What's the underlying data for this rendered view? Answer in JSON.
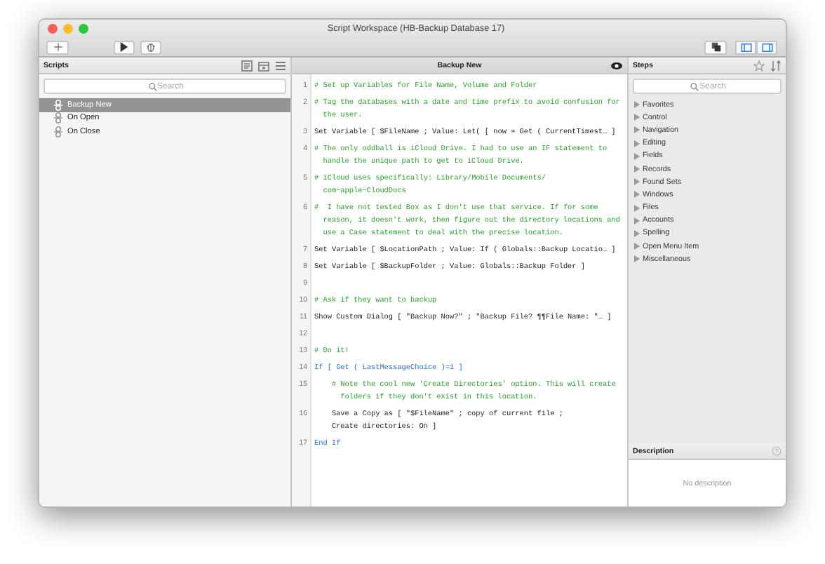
{
  "window": {
    "title": "Script Workspace (HB-Backup Database 17)"
  },
  "toolbar": {
    "pane_toggles": [
      {
        "selected": true
      },
      {
        "selected": true
      }
    ]
  },
  "scripts_pane": {
    "title": "Scripts",
    "search": {
      "placeholder": "Search"
    },
    "items": [
      {
        "label": "Backup New",
        "selected": true
      },
      {
        "label": "On Open",
        "selected": false
      },
      {
        "label": "On Close",
        "selected": false
      }
    ]
  },
  "editor": {
    "title": "Backup New",
    "lines": [
      {
        "number": "1",
        "kind": "comment",
        "text": "# Set up Variables for File Name, Volume and Folder"
      },
      {
        "number": "2",
        "kind": "comment",
        "text": "# Tag the databases with a date and time prefix to avoid confusion for the user."
      },
      {
        "number": "3",
        "kind": "step",
        "text": "Set Variable [ $FileName ; Value: Let( [ now = Get ( CurrentTimest… ]"
      },
      {
        "number": "4",
        "kind": "comment",
        "text": "# The only oddball is iCloud Drive. I had to use an IF statement to handle the unique path to get to iCloud Drive."
      },
      {
        "number": "5",
        "kind": "comment",
        "text": "# iCloud uses specifically: Library/Mobile Documents/\ncom~apple~CloudDocs"
      },
      {
        "number": "6",
        "kind": "comment",
        "text": "#  I have not tested Box as I don't use that service. If for some reason, it doesn't work, then figure out the directory locations and use a Case statement to deal with the precise location."
      },
      {
        "number": "7",
        "kind": "step",
        "text": "Set Variable [ $LocationPath ; Value: If ( Globals::Backup Locatio… ]"
      },
      {
        "number": "8",
        "kind": "step",
        "text": "Set Variable [ $BackupFolder ; Value: Globals::Backup Folder ]"
      },
      {
        "number": "9",
        "kind": "blank"
      },
      {
        "number": "10",
        "kind": "comment",
        "text": "# Ask if they want to backup"
      },
      {
        "number": "11",
        "kind": "step",
        "text": "Show Custom Dialog [ \"Backup Now?\" ; \"Backup File? ¶¶File Name: \"… ]"
      },
      {
        "number": "12",
        "kind": "blank"
      },
      {
        "number": "13",
        "kind": "comment",
        "text": "# Do it!"
      },
      {
        "number": "14",
        "kind": "control",
        "text": "If [ Get ( LastMessageChoice )=1 ]",
        "children": [
          {
            "number": "15",
            "kind": "comment",
            "text": "# Note the cool new 'Create Directories' option. This will create folders if they don't exist in this location."
          },
          {
            "number": "16",
            "kind": "step",
            "text": "Save a Copy as [ \"$FileName\" ; copy of current file ;\nCreate directories: On ]"
          }
        ]
      },
      {
        "number": "17",
        "kind": "control",
        "text": "End If"
      }
    ]
  },
  "steps_pane": {
    "title": "Steps",
    "search": {
      "placeholder": "Search"
    },
    "categories": [
      {
        "label": "Favorites",
        "expanded": false
      },
      {
        "label": "Control",
        "expanded": false
      },
      {
        "label": "Navigation",
        "expanded": false
      },
      {
        "label": "Editing",
        "expanded": false
      },
      {
        "label": "Fields",
        "expanded": false
      },
      {
        "label": "Records",
        "expanded": false
      },
      {
        "label": "Found Sets",
        "expanded": false
      },
      {
        "label": "Windows",
        "expanded": false
      },
      {
        "label": "Files",
        "expanded": false
      },
      {
        "label": "Accounts",
        "expanded": false
      },
      {
        "label": "Spelling",
        "expanded": false
      },
      {
        "label": "Open Menu Item",
        "expanded": false
      },
      {
        "label": "Miscellaneous",
        "expanded": false
      }
    ]
  },
  "description": {
    "title": "Description",
    "text": "No description"
  }
}
